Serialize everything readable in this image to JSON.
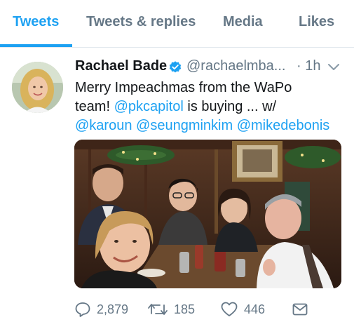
{
  "tabs": [
    {
      "label": "Tweets",
      "active": true
    },
    {
      "label": "Tweets & replies",
      "active": false
    },
    {
      "label": "Media",
      "active": false
    },
    {
      "label": "Likes",
      "active": false
    }
  ],
  "tweet": {
    "author_name": "Rachael Bade",
    "verified_icon": "verified-badge-icon",
    "handle": "@rachaelmba...",
    "time": "· 1h",
    "text": {
      "line1": "Merry Impeachmas from the WaPo",
      "line2_a": "team! ",
      "line2_mention": "@pkcapitol",
      "line2_b": " is buying ... w/",
      "mentions_line3": [
        "@karoun",
        "@seungminkim",
        "@mikedebonis"
      ]
    },
    "actions": {
      "reply_count": "2,879",
      "retweet_count": "185",
      "like_count": "446"
    }
  },
  "colors": {
    "accent": "#1da1f2",
    "muted": "#657786",
    "text": "#14171a",
    "divider": "#e1e8ed"
  }
}
